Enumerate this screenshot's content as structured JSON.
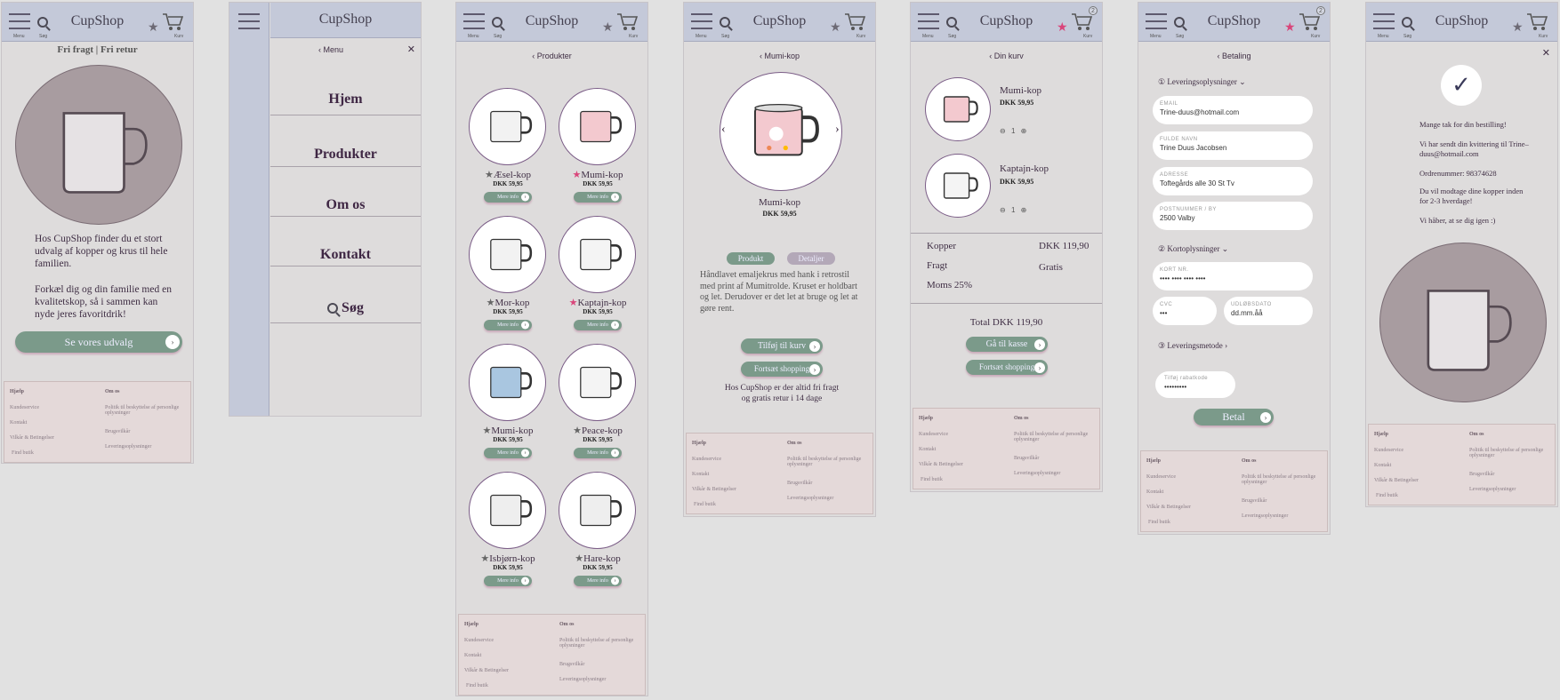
{
  "app": {
    "name": "CupShop",
    "menu_label": "Menu",
    "search_label": "Søg",
    "cart_label": "Kurv",
    "cart_count": "2"
  },
  "colors": {
    "header": "#c4c9d9",
    "accent_green": "#7b9a8a",
    "footer": "#e4d9d9",
    "favorite": "#d9457a"
  },
  "footer": {
    "col1_title": "Hjælp",
    "col1": [
      "Kundeservice",
      "Kontakt",
      "Vilkår & Betingelser",
      "Find butik"
    ],
    "col2_title": "Om os",
    "col2": [
      "Politik til beskyttelse af personlige oplysninger",
      "Brugsvilkår",
      "Leveringsoplysninger"
    ]
  },
  "home": {
    "banner": "Fri fragt | Fri retur",
    "p1": "Hos CupShop finder du et stort udvalg af kopper og krus til hele familien.",
    "p2": "Forkæl dig og din familie med en kvalitetskop, så i sammen kan nyde jeres favoritdrik!",
    "cta": "Se vores udvalg"
  },
  "menu": {
    "title": "Menu",
    "close": "✕",
    "items": [
      "Hjem",
      "Produkter",
      "Om os",
      "Kontakt",
      "Søg"
    ]
  },
  "products": {
    "back": "Produkter",
    "more": "Mere info",
    "items": [
      {
        "name": "Æsel-kop",
        "price": "DKK 59,95",
        "fav": false
      },
      {
        "name": "Mumi-kop",
        "price": "DKK 59,95",
        "fav": true
      },
      {
        "name": "Mor-kop",
        "price": "DKK 59,95",
        "fav": false
      },
      {
        "name": "Kaptajn-kop",
        "price": "DKK 59,95",
        "fav": true
      },
      {
        "name": "Mumi-kop",
        "price": "DKK 59,95",
        "fav": false
      },
      {
        "name": "Peace-kop",
        "price": "DKK 59,95",
        "fav": false
      },
      {
        "name": "Isbjørn-kop",
        "price": "DKK 59,95",
        "fav": false
      },
      {
        "name": "Hare-kop",
        "price": "DKK 59,95",
        "fav": false
      }
    ]
  },
  "detail": {
    "back": "Mumi-kop",
    "name": "Mumi-kop",
    "price": "DKK 59,95",
    "tab1": "Produkt",
    "tab2": "Detaljer",
    "desc": "Håndlavet emaljekrus med hank i retrostil med print af Mumitrolde. Kruset er holdbart og let. Derudover er det let at bruge og let at gøre rent.",
    "add": "Tilføj til kurv",
    "continue": "Fortsæt shopping",
    "note": "Hos CupShop er der altid fri fragt og gratis retur i 14 dage"
  },
  "cart": {
    "back": "Din kurv",
    "items": [
      {
        "name": "Mumi-kop",
        "price": "DKK 59,95",
        "qty": "1"
      },
      {
        "name": "Kaptajn-kop",
        "price": "DKK 59,95",
        "qty": "1"
      }
    ],
    "rows": [
      {
        "k": "Kopper",
        "v": "DKK 119,90"
      },
      {
        "k": "Fragt",
        "v": "Gratis"
      },
      {
        "k": "Moms 25%",
        "v": ""
      }
    ],
    "total": "Total DKK 119,90",
    "checkout": "Gå til kasse",
    "continue": "Fortsæt shopping"
  },
  "payment": {
    "back": "Betaling",
    "s1": "Leveringsoplysninger",
    "s2": "Kortoplysninger",
    "s3": "Leveringsmetode",
    "fields": [
      {
        "label": "EMAIL",
        "value": "Trine-duus@hotmail.com"
      },
      {
        "label": "FULDE NAVN",
        "value": "Trine Duus Jacobsen"
      },
      {
        "label": "ADRESSE",
        "value": "Toftegårds alle 30 St Tv"
      },
      {
        "label": "POSTNUMMER / BY",
        "value": "2500 Valby"
      }
    ],
    "card": {
      "label": "KORT NR.",
      "value": "•••• •••• •••• ••••"
    },
    "cvc": {
      "label": "CVC",
      "value": "•••"
    },
    "exp": {
      "label": "UDLØBSDATO",
      "value": "dd.mm.åå"
    },
    "promo": {
      "label": "Tilføj rabatkode",
      "value": "•••••••••"
    },
    "pay": "Betal"
  },
  "confirm": {
    "lines": [
      "Mange tak for din bestilling!",
      "Vi har sendt din kvittering til Trine–duus@hotmail.com",
      "Ordrenummer: 98374628",
      "Du vil modtage dine kopper inden for 2-3 hverdage!",
      "Vi håber, at se dig igen :)"
    ]
  }
}
